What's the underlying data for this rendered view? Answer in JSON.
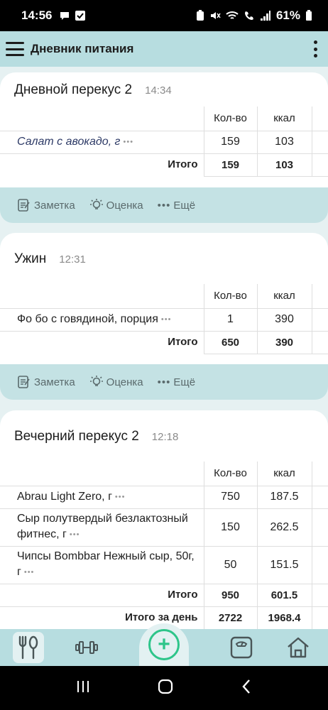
{
  "status_bar": {
    "time": "14:56",
    "battery": "61%",
    "icons": [
      "chat-icon",
      "check-icon",
      "battery-saver-icon",
      "mute-icon",
      "wifi-icon",
      "call-icon",
      "signal-icon"
    ]
  },
  "appbar": {
    "title": "Дневник питания"
  },
  "columns": {
    "qty": "Кол-во",
    "kcal": "ккал"
  },
  "actions": {
    "note": "Заметка",
    "rating": "Оценка",
    "more": "Ещё"
  },
  "meals": [
    {
      "title": "Дневной перекус 2",
      "time": "14:34",
      "items": [
        {
          "name": "Салат с авокадо, г",
          "qty": "159",
          "kcal": "103"
        }
      ],
      "total_label": "Итого",
      "total_qty": "159",
      "total_kcal": "103"
    },
    {
      "title": "Ужин",
      "time": "12:31",
      "items": [
        {
          "name": "Фо бо с говядиной, порция",
          "qty": "1",
          "kcal": "390"
        }
      ],
      "total_label": "Итого",
      "total_qty": "650",
      "total_kcal": "390"
    },
    {
      "title": "Вечерний перекус 2",
      "time": "12:18",
      "items": [
        {
          "name": "Abrau Light Zero, г",
          "qty": "750",
          "kcal": "187.5"
        },
        {
          "name": "Сыр полутвердый безлактозный фитнес, г",
          "qty": "150",
          "kcal": "262.5"
        },
        {
          "name": "Чипсы Bombbar Нежный сыр, 50г, г",
          "qty": "50",
          "kcal": "151.5"
        }
      ],
      "total_label": "Итого",
      "total_qty": "950",
      "total_kcal": "601.5"
    }
  ],
  "day_total": {
    "label": "Итого за день",
    "qty": "2722",
    "kcal": "1968.4"
  },
  "bottom_nav": {
    "items": [
      "diary-icon",
      "workout-icon",
      "add-icon",
      "scale-icon",
      "home-icon"
    ],
    "add_symbol": "+"
  },
  "colors": {
    "accent": "#2ec58a",
    "header": "#b7dde0",
    "action_bar": "#c4e2e4"
  }
}
